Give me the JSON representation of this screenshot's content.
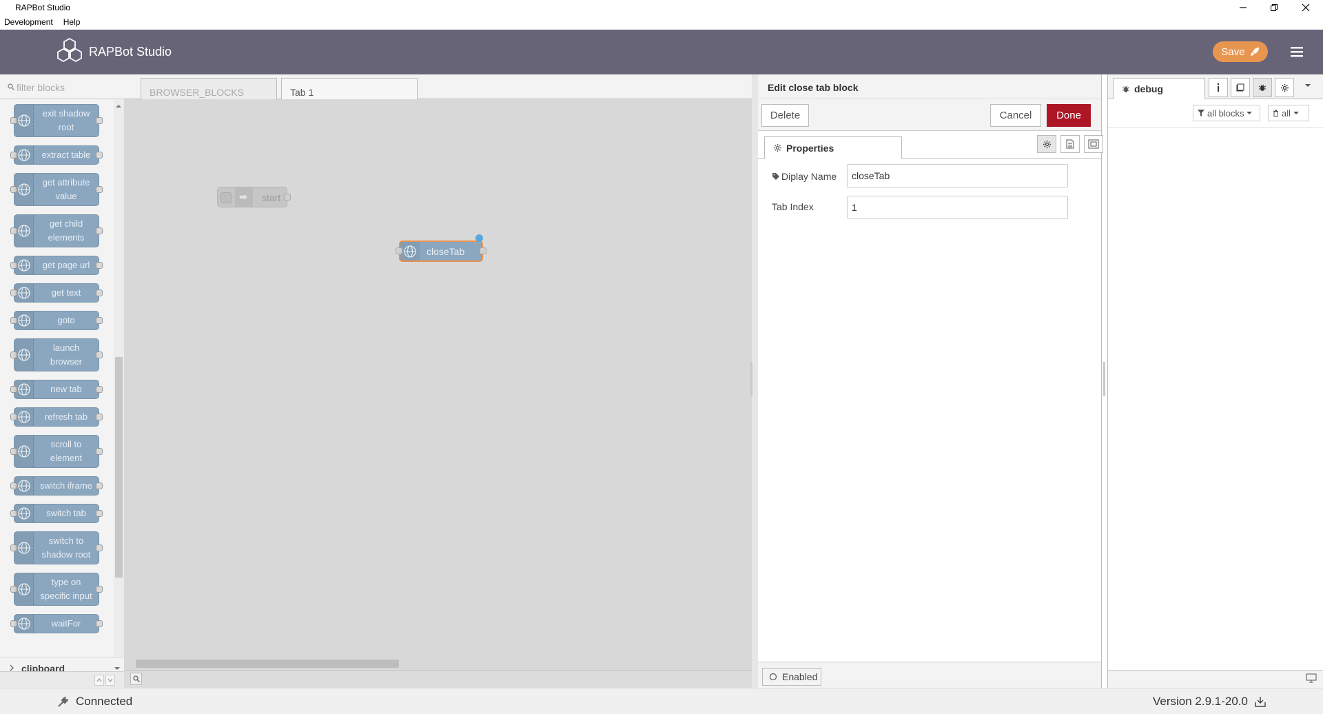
{
  "window": {
    "title": "RAPBot Studio",
    "menu": [
      "Development",
      "Help"
    ]
  },
  "header": {
    "app_name": "RAPBot Studio",
    "save_label": "Save",
    "accent_color": "#e89550",
    "header_color": "#676478"
  },
  "palette": {
    "filter_placeholder": "filter blocks",
    "nodes": [
      {
        "label": "exit shadow root"
      },
      {
        "label": "extract table"
      },
      {
        "label": "get attribute value"
      },
      {
        "label": "get child elements"
      },
      {
        "label": "get page url"
      },
      {
        "label": "get text"
      },
      {
        "label": "goto"
      },
      {
        "label": "launch browser"
      },
      {
        "label": "new tab"
      },
      {
        "label": "refresh tab"
      },
      {
        "label": "scroll to element"
      },
      {
        "label": "switch iframe"
      },
      {
        "label": "switch tab"
      },
      {
        "label": "switch to shadow root"
      },
      {
        "label": "type on specific input"
      },
      {
        "label": "waitFor"
      }
    ],
    "category": "clipboard"
  },
  "workspace": {
    "tabs": [
      {
        "label": "BROWSER_BLOCKS"
      },
      {
        "label": "Tab 1"
      }
    ],
    "nodes": {
      "start": "start",
      "closeTab": "closeTab"
    }
  },
  "editor": {
    "title": "Edit close tab block",
    "delete_label": "Delete",
    "cancel_label": "Cancel",
    "done_label": "Done",
    "properties_tab": "Properties",
    "fields": [
      {
        "label": "Diplay Name",
        "value": "closeTab"
      },
      {
        "label": "Tab Index",
        "value": "1"
      }
    ],
    "enabled_label": "Enabled"
  },
  "sidebar": {
    "tab_label": "debug",
    "filter_label": "all blocks",
    "clear_label": "all"
  },
  "status": {
    "connection": "Connected",
    "version": "Version 2.9.1-20.0"
  }
}
